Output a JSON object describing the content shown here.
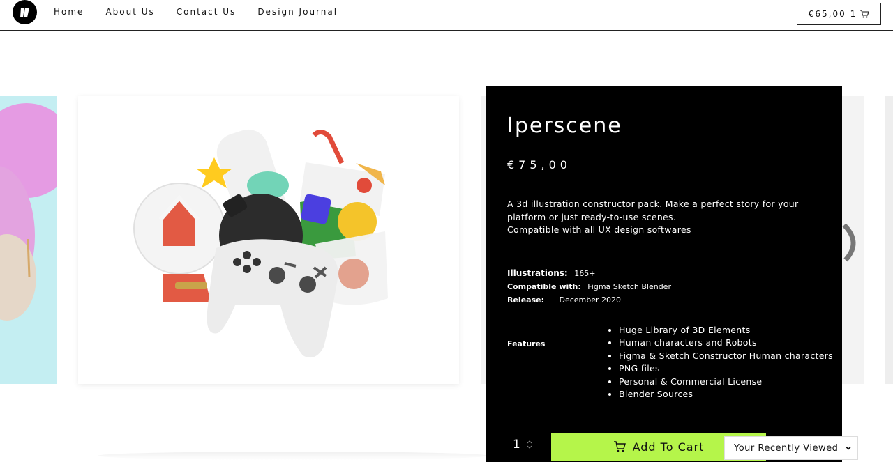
{
  "nav": {
    "items": [
      "Home",
      "About Us",
      "Contact Us",
      "Design Journal"
    ],
    "cart_total": "€65,00 1"
  },
  "product": {
    "title": "Iperscene",
    "price": "€75,00",
    "description_lines": [
      "A 3d illustration constructor pack. Make a perfect story for your",
      "platform or just ready-to-use scenes.",
      "Compatible with all UX design softwares"
    ],
    "meta": {
      "illustrations_label": "Illustrations:",
      "illustrations_value": "165+",
      "compatible_label": "Compatible with:",
      "compatible_value": "Figma Sketch Blender",
      "release_label": "Release:",
      "release_value": "December 2020"
    },
    "features_label": "Features",
    "features": [
      "Huge Library of 3D Elements",
      "Human characters and Robots",
      "Figma & Sketch Constructor Human characters",
      "PNG files",
      "Personal & Commercial License",
      "Blender Sources"
    ],
    "quantity": "1",
    "add_to_cart_label": "Add To Cart"
  },
  "recently_viewed": {
    "label": "Your Recently Viewed"
  },
  "colors": {
    "accent_green": "#b5f54a",
    "card_bg": "#000000",
    "left_panel_bg": "#c4eef2"
  }
}
